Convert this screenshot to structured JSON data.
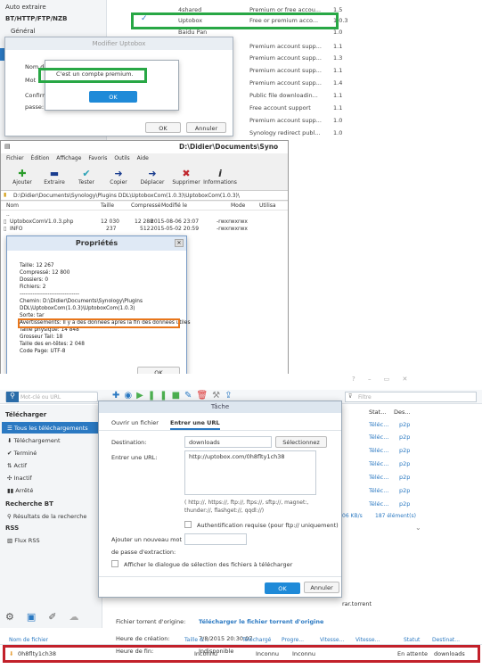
{
  "p1": {
    "sidebar": [
      "Auto extraire",
      "BT/HTTP/FTP/NZB",
      "Général"
    ],
    "hosts": [
      {
        "name": "4shared",
        "desc": "Premium or free accou...",
        "ver": "1.5"
      },
      {
        "name": "Uptobox",
        "desc": "Free or premium acco...",
        "ver": "1.0.3"
      },
      {
        "name": "Baidu Pan",
        "desc": "",
        "ver": "1.0"
      },
      {
        "name": "",
        "desc": "Premium account supp...",
        "ver": "1.1"
      },
      {
        "name": "",
        "desc": "Premium account supp...",
        "ver": "1.3"
      },
      {
        "name": "",
        "desc": "Premium account supp...",
        "ver": "1.1"
      },
      {
        "name": "",
        "desc": "Premium account supp...",
        "ver": "1.4"
      },
      {
        "name": "",
        "desc": "Public file downloadin...",
        "ver": "1.1"
      },
      {
        "name": "",
        "desc": "Free account support",
        "ver": "1.1"
      },
      {
        "name": "",
        "desc": "Premium account supp...",
        "ver": "1.0"
      },
      {
        "name": "",
        "desc": "Synology redirect publ...",
        "ver": "1.0"
      }
    ],
    "dialog_title": "Modifier Uptobox",
    "dialog_labels": [
      "Nom d",
      "Mot",
      "Confirm",
      "passe:"
    ],
    "alert_text": "C'est un compte premium.",
    "ok": "OK",
    "cancel": "Annuler"
  },
  "p2": {
    "title": "D:\\Didier\\Documents\\Syno",
    "menu": [
      "Fichier",
      "Édition",
      "Affichage",
      "Favoris",
      "Outils",
      "Aide"
    ],
    "toolbar": [
      {
        "label": "Ajouter",
        "icon": "+"
      },
      {
        "label": "Extraire",
        "icon": "−"
      },
      {
        "label": "Tester",
        "icon": "✓"
      },
      {
        "label": "Copier",
        "icon": "➜"
      },
      {
        "label": "Déplacer",
        "icon": "➜"
      },
      {
        "label": "Supprimer",
        "icon": "✖"
      },
      {
        "label": "Informations",
        "icon": "i"
      }
    ],
    "path": "D:\\Didier\\Documents\\Synology\\Plugins DDL\\UptoboxCom(1.0.3)\\UptoboxCom(1.0.3)\\",
    "columns": [
      "Nom",
      "Taille",
      "Compressé",
      "Modifié le",
      "Mode",
      "Utilisa"
    ],
    "files": [
      {
        "name": "..",
        "size": "",
        "comp": "",
        "date": "",
        "mode": ""
      },
      {
        "name": "UptoboxComV1.0.3.php",
        "size": "12 030",
        "comp": "12 288",
        "date": "2015-08-06 23:07",
        "mode": "-rwxrwxrwx"
      },
      {
        "name": "INFO",
        "size": "237",
        "comp": "512",
        "date": "2015-05-02 20:59",
        "mode": "-rwxrwxrwx"
      }
    ],
    "props_title": "Propriétés",
    "props_lines": [
      "Taille: 12 267",
      "Compressé: 12 800",
      "Dossiers: 0",
      "Fichiers: 2",
      "--------------------------------",
      "Chemin: D:\\Didier\\Documents\\Synology\\Plugins",
      "DDL\\UptoboxCom(1.0.3)\\UptoboxCom(1.0.3)",
      "Sorte: tar",
      "Avertissements: Il y a des données après la fin des données utiles",
      "Taille physique: 14 848",
      "Grosseur Tail: 18",
      "Taille des en-têtes: 2 048",
      "Code Page: UTF-8"
    ],
    "ok": "OK"
  },
  "p3": {
    "search_placeholder": "Mot-clé ou URL",
    "filter_placeholder": "Filtre",
    "sidebar": {
      "download_section": "Télécharger",
      "items": [
        "Tous les téléchargements",
        "Téléchargement",
        "Terminé",
        "Actif",
        "Inactif",
        "Arrêté"
      ],
      "bt_section": "Recherche BT",
      "bt_item": "Résultats de la recherche",
      "rss_section": "RSS",
      "rss_item": "Flux RSS"
    },
    "right_cols": [
      "Stat...",
      "Des..."
    ],
    "right_rows": [
      [
        "Téléc...",
        "p2p"
      ],
      [
        "Téléc...",
        "p2p"
      ],
      [
        "Téléc...",
        "p2p"
      ],
      [
        "Téléc...",
        "p2p"
      ],
      [
        "Téléc...",
        "p2p"
      ],
      [
        "Téléc...",
        "p2p"
      ],
      [
        "Téléc...",
        "p2p"
      ]
    ],
    "speed": "06 KB/s",
    "count": "187 élément(s)",
    "torrent_suffix": "rar.torrent",
    "task": {
      "title": "Tâche",
      "tab_file": "Ouvrir un fichier",
      "tab_url": "Entrer une URL",
      "dest_label": "Destination:",
      "dest_value": "downloads",
      "select_btn": "Sélectionnez",
      "url_label": "Entrer une URL:",
      "url_value": "http://uptobox.com/0h8flty1ch38",
      "hint1": "( http://, https://, ftp://, ftps://, sftp://, magnet:,",
      "hint2": "thunder://, flashget://, qqdl://)",
      "auth": "Authentification requise (pour ftp:// uniquement)",
      "pwd_label1": "Ajouter un nouveau mot",
      "pwd_label2": "de passe d'extraction:",
      "show_dialog": "Afficher le dialogue de sélection des fichiers à télécharger",
      "ok": "OK",
      "cancel": "Annuler"
    },
    "details": [
      {
        "k": "Heure de création:",
        "v": "7/8/2015 20:30:07"
      },
      {
        "k": "Heure de fin:",
        "v": "Indisponible"
      },
      {
        "k": "Fichier torrent d'origine:",
        "v": "Télécharger le fichier torrent d'origine"
      }
    ],
    "table_cols": [
      "Nom de fichier",
      "Taille d...",
      "Téléchargé",
      "Progre...",
      "Vitesse...",
      "Vitesse...",
      "Statut",
      "Destinat..."
    ],
    "table_row": [
      "0h8flty1ch38",
      "Inconnu",
      "Inconnu",
      "Inconnu",
      "",
      "",
      "En attente",
      "downloads"
    ]
  }
}
